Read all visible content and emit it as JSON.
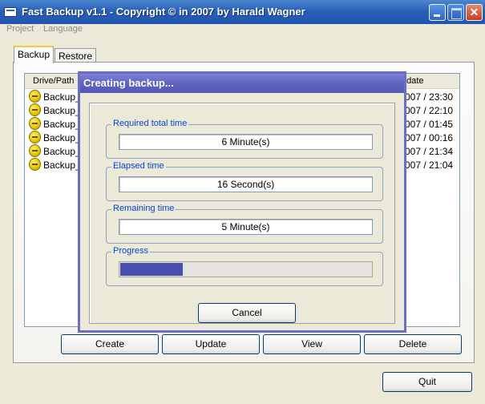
{
  "window": {
    "title": "Fast Backup v1.1 - Copyright © in 2007 by Harald Wagner",
    "app_icon": "window-icon",
    "controls": {
      "minimize": "minimize-icon",
      "maximize": "maximize-icon",
      "close_glyph": "✕"
    }
  },
  "menu": {
    "project": "Project",
    "language": "Language"
  },
  "tabs": {
    "backup": "Backup",
    "restore": "Restore"
  },
  "list": {
    "columns": {
      "drive_path": "Drive/Path",
      "update": "odate"
    },
    "rows": [
      {
        "name": "Backup_",
        "date": "007 / 23:30"
      },
      {
        "name": "Backup_",
        "date": "007 / 22:10"
      },
      {
        "name": "Backup_",
        "date": "007 / 01:45"
      },
      {
        "name": "Backup_",
        "date": "007 / 00:16"
      },
      {
        "name": "Backup_",
        "date": "007 / 21:34"
      },
      {
        "name": "Backup_",
        "date": "007 / 21:04"
      }
    ]
  },
  "buttons": {
    "create": "Create",
    "update": "Update",
    "view": "View",
    "delete": "Delete",
    "quit": "Quit"
  },
  "dialog": {
    "title": "Creating backup...",
    "required_label": "Required total time",
    "required_value": "6 Minute(s)",
    "elapsed_label": "Elapsed time",
    "elapsed_value": "16 Second(s)",
    "remaining_label": "Remaining time",
    "remaining_value": "5 Minute(s)",
    "progress_label": "Progress",
    "progress_fraction": 0.25,
    "cancel": "Cancel"
  },
  "colors": {
    "titlebar": "#2a5fb8",
    "dialog_frame": "#6a6ec6",
    "progress_fill": "#4a4fae",
    "group_label": "#0046d5"
  }
}
